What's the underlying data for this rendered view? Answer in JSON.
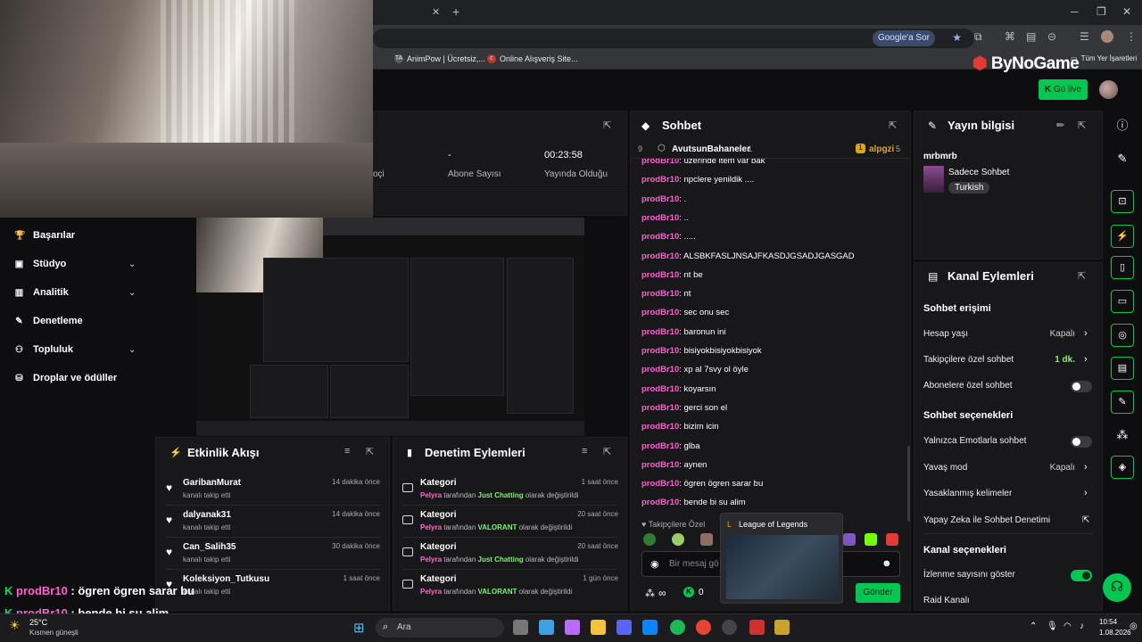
{
  "browser": {
    "google_btn": "Google'a Sor",
    "bookmarks": [
      {
        "icon": "TA",
        "label": "AnimPow | Ücretsiz,..."
      },
      {
        "icon": "c",
        "label": "Online Alışveriş Site..."
      }
    ],
    "all_bookmarks": "Tüm Yer İşaretleri"
  },
  "site": {
    "logo_by": "By",
    "logo_rest": "NoGame",
    "go_live": "Go live"
  },
  "nav": [
    {
      "label": "Başarılar",
      "icon": "trophy-icon",
      "glyph": "🏆",
      "chev": false
    },
    {
      "label": "Stüdyo",
      "icon": "studio-icon",
      "glyph": "▣",
      "chev": true
    },
    {
      "label": "Analitik",
      "icon": "chart-icon",
      "glyph": "▥",
      "chev": true
    },
    {
      "label": "Denetleme",
      "icon": "wrench-icon",
      "glyph": "✎",
      "chev": false
    },
    {
      "label": "Topluluk",
      "icon": "community-icon",
      "glyph": "⚇",
      "chev": true
    },
    {
      "label": "Droplar ve ödüller",
      "icon": "drops-icon",
      "glyph": "⛁",
      "chev": false
    }
  ],
  "stats": [
    {
      "value": "",
      "label": "oçi"
    },
    {
      "value": "-",
      "label": "Abone Sayısı"
    },
    {
      "value": "00:23:58",
      "label": "Yayında Olduğu"
    }
  ],
  "events": {
    "title": "Etkinlik Akışı",
    "items": [
      {
        "name": "GaribanMurat",
        "sub": "kanalı takip etti",
        "time": "14 dakika önce"
      },
      {
        "name": "dalyanak31",
        "sub": "kanalı takip etti",
        "time": "14 dakika önce"
      },
      {
        "name": "Can_Salih35",
        "sub": "kanalı takip etti",
        "time": "30 dakika önce"
      },
      {
        "name": "Koleksiyon_Tutkusu",
        "sub": "kanalı takip etti",
        "time": "1 saat önce"
      }
    ]
  },
  "modactions": {
    "title": "Denetim Eylemleri",
    "items": [
      {
        "name": "Kategori",
        "user": "Pelyra",
        "mid": " tarafından ",
        "game": "Just Chatting",
        "end": " olarak değiştirildi",
        "time": "1 saat önce"
      },
      {
        "name": "Kategori",
        "user": "Pelyra",
        "mid": " tarafından ",
        "game": "VALORANT",
        "end": " olarak değiştirildi",
        "time": "20 saat önce"
      },
      {
        "name": "Kategori",
        "user": "Pelyra",
        "mid": " tarafından ",
        "game": "Just Chatting",
        "end": " olarak değiştirildi",
        "time": "20 saat önce"
      },
      {
        "name": "Kategori",
        "user": "Pelyra",
        "mid": " tarafından ",
        "game": "VALORANT",
        "end": " olarak değiştirildi",
        "time": "1 gün önce"
      }
    ]
  },
  "chat": {
    "title": "Sohbet",
    "pinned_left": "9",
    "pinned_user": "AvutsunBahaneler",
    "pinned_count": "1",
    "pinned_right_user": "alpgzi",
    "pinned_right_num": "5",
    "messages": [
      {
        "user": "prodBr10",
        "text": ": üzerinde item var bak"
      },
      {
        "user": "prodBr10",
        "text": ": npclere yenildik ...."
      },
      {
        "user": "prodBr10",
        "text": ": ."
      },
      {
        "user": "prodBr10",
        "text": ": .."
      },
      {
        "user": "prodBr10",
        "text": ": ....."
      },
      {
        "user": "prodBr10",
        "text": ": ALSBKFASLJNSAJFKASDJGSADJGASGAD"
      },
      {
        "user": "prodBr10",
        "text": ": nt be"
      },
      {
        "user": "prodBr10",
        "text": ": nt"
      },
      {
        "user": "prodBr10",
        "text": ": sec onu sec"
      },
      {
        "user": "prodBr10",
        "text": ": baronun ini"
      },
      {
        "user": "prodBr10",
        "text": ": bisiyokbisiyokbisiyok"
      },
      {
        "user": "prodBr10",
        "text": ": xp al 7svy ol öyle"
      },
      {
        "user": "prodBr10",
        "text": ": koyarsın"
      },
      {
        "user": "prodBr10",
        "text": ": gerci son el"
      },
      {
        "user": "prodBr10",
        "text": ": bizim icin"
      },
      {
        "user": "prodBr10",
        "text": ": glba"
      },
      {
        "user": "prodBr10",
        "text": ": aynen"
      },
      {
        "user": "prodBr10",
        "text": ": ögren ögren sarar bu"
      },
      {
        "user": "prodBr10",
        "text": ": bende bi su alim"
      }
    ],
    "followers_only": "Takipçilere Özel",
    "input_placeholder": "Bir mesaj gö",
    "send": "Gönder",
    "infinity": "∞",
    "points": "0"
  },
  "tooltip": {
    "title": "League of Legends"
  },
  "stream_info": {
    "title": "Yayın bilgisi",
    "user": "mrbmrb",
    "category": "Sadece Sohbet",
    "tag": "Turkish"
  },
  "channel": {
    "title": "Kanal Eylemleri",
    "chat_access": "Sohbet erişimi",
    "rows1": [
      {
        "label": "Hesap yaşı",
        "value": "Kapalı",
        "type": "link"
      },
      {
        "label": "Takipçilere özel sohbet",
        "value": "1 dk.",
        "type": "link",
        "green": true
      },
      {
        "label": "Abonelere özel sohbet",
        "value": "",
        "type": "toggle",
        "on": false
      }
    ],
    "chat_options": "Sohbet seçenekleri",
    "rows2": [
      {
        "label": "Yalnızca Emotlarla sohbet",
        "value": "",
        "type": "toggle",
        "on": false
      },
      {
        "label": "Yavaş mod",
        "value": "Kapalı",
        "type": "link"
      },
      {
        "label": "Yasaklanmış kelimeler",
        "value": "",
        "type": "link"
      },
      {
        "label": "Yapay Zeka ile Sohbet Denetimi",
        "value": "",
        "type": "ext"
      }
    ],
    "channel_options": "Kanal seçenekleri",
    "rows3": [
      {
        "label": "İzlenme sayısını göster",
        "value": "",
        "type": "toggle",
        "on": true
      },
      {
        "label": "Raid Kanalı",
        "value": "",
        "type": "none"
      }
    ]
  },
  "overlay": [
    {
      "user": "prodBr10",
      "text": " : ögren ögren sarar bu"
    },
    {
      "user": "prodBr10",
      "text": " : bende bi su alim"
    }
  ],
  "taskbar": {
    "temp": "25°C",
    "weather": "Kısmen güneşli",
    "search": "Ara",
    "time": "10:54",
    "date": "1.08.2026"
  },
  "colors": {
    "accent": "#00c853",
    "username": "#ff5fd2",
    "brand_red": "#e53935"
  }
}
